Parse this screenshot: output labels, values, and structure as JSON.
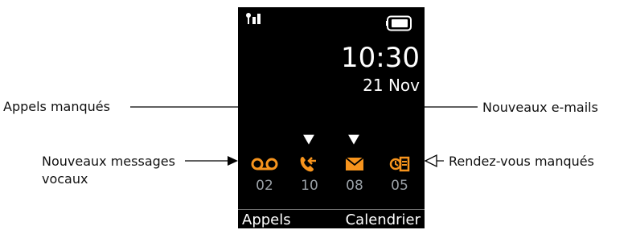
{
  "screen": {
    "time": "10:30",
    "date": "21 Nov",
    "accent_color": "#f7941d",
    "status_items": [
      {
        "icon": "voicemail-icon",
        "count": "02"
      },
      {
        "icon": "missed-call-icon",
        "count": "10"
      },
      {
        "icon": "email-icon",
        "count": "08"
      },
      {
        "icon": "missed-appointment-icon",
        "count": "05"
      }
    ],
    "softkeys": {
      "left": "Appels",
      "right": "Calendrier"
    },
    "top_icons": [
      "signal-icon",
      "battery-icon"
    ]
  },
  "callouts": {
    "missed_calls": "Appels manqués",
    "new_emails": "Nouveaux e-mails",
    "new_voice_messages_line1": "Nouveaux messages",
    "new_voice_messages_line2": "vocaux",
    "missed_appointments": "Rendez-vous manqués"
  }
}
